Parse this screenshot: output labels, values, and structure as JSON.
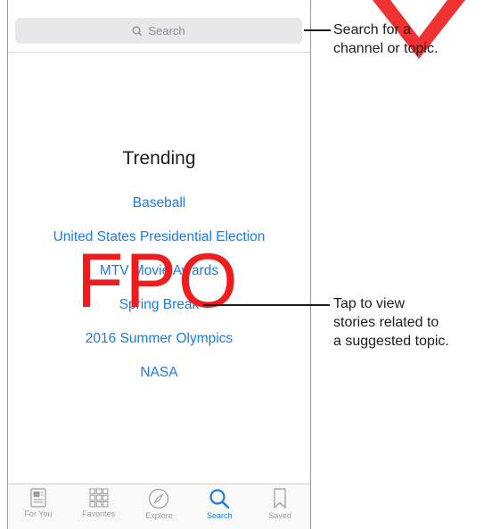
{
  "search": {
    "placeholder": "Search"
  },
  "trending": {
    "title": "Trending",
    "topics": [
      "Baseball",
      "United States Presidential Election",
      "MTV Movie Awards",
      "Spring Break",
      "2016 Summer Olympics",
      "NASA"
    ]
  },
  "tabbar": {
    "tabs": [
      {
        "label": "For You",
        "icon": "for-you-icon"
      },
      {
        "label": "Favorites",
        "icon": "favorites-grid-icon"
      },
      {
        "label": "Explore",
        "icon": "compass-icon"
      },
      {
        "label": "Search",
        "icon": "search-icon",
        "active": true
      },
      {
        "label": "Saved",
        "icon": "bookmark-icon"
      }
    ]
  },
  "overlay": {
    "placeholder_stamp": "FPO"
  },
  "callouts": {
    "search": [
      "Search for a",
      "channel or topic."
    ],
    "topic": [
      "Tap to view",
      "stories related to",
      "a suggested topic."
    ]
  },
  "colors": {
    "accent": "#1a7de3",
    "fpo": "#ee1c1c",
    "watermark": "#ee1c1c"
  }
}
